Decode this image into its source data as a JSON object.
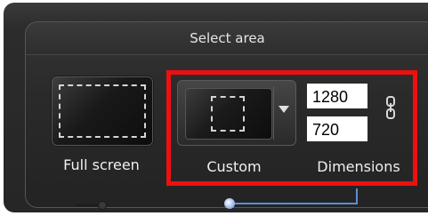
{
  "dialog": {
    "title": "Select area",
    "options": {
      "full_screen_label": "Full screen",
      "custom_label": "Custom",
      "dimensions_label": "Dimensions"
    },
    "dimensions": {
      "width": "1280",
      "height": "720"
    },
    "icons": {
      "dropdown": "triangle-down-icon",
      "link": "chain-link-icon"
    },
    "colors": {
      "highlight": "#ee1010",
      "accent_slider": "#5b8fd6"
    }
  }
}
